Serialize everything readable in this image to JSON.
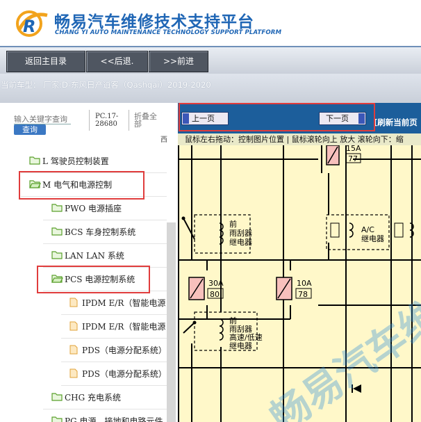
{
  "header": {
    "title": "畅易汽车维修技术支持平台",
    "subtitle": "CHANG YI AUTO MAINTENANCE TECHNOLOGY SUPPORT PLATFORM"
  },
  "toolbar": {
    "home_label": "返回主目录",
    "back_label": "<<后退.",
    "forward_label": ">>前进"
  },
  "vehicle": {
    "text": "当前车型：   厂家:D-东风日产逍客（Qashqai）2019-2020"
  },
  "sidebar": {
    "search_placeholder": "输入关键字查询",
    "search_button": "查询",
    "pc_code": "PC.17-28680",
    "collapse_label": "折叠全部",
    "tiny_glyph": "西",
    "items": [
      {
        "label": "L 驾驶员控制装置",
        "kind": "folder"
      },
      {
        "label": "M 电气和电源控制",
        "kind": "folder-open"
      },
      {
        "label": "PWO 电源插座",
        "kind": "folder"
      },
      {
        "label": "BCS 车身控制系统",
        "kind": "folder"
      },
      {
        "label": "LAN LAN 系统",
        "kind": "folder"
      },
      {
        "label": "PCS 电源控制系统",
        "kind": "folder-open"
      },
      {
        "label": "IPDM E/R（智能电源",
        "kind": "page"
      },
      {
        "label": "IPDM E/R（智能电源",
        "kind": "page"
      },
      {
        "label": "PDS（电源分配系统）",
        "kind": "page"
      },
      {
        "label": "PDS（电源分配系统）",
        "kind": "page"
      },
      {
        "label": "CHG 充电系统",
        "kind": "folder"
      },
      {
        "label": "PG 电源、接地和电路元件",
        "kind": "folder"
      }
    ]
  },
  "content": {
    "prev_page": "上一页",
    "next_page": "下一页",
    "refresh_label": "[刷新当前页",
    "hint": "鼠标左右拖动：控制图片位置 | 鼠标滚轮向上 放大  滚轮向下：缩",
    "diagram": {
      "fuse_top": "15A",
      "fuse_top_num": "77",
      "relay1_label": [
        "前",
        "雨刮器",
        "继电器"
      ],
      "ac_relay_label": [
        "A/C",
        "继电器"
      ],
      "fuse_left": "30A",
      "fuse_left_num": "80",
      "fuse_mid": "10A",
      "fuse_mid_num": "78",
      "relay2_label": [
        "前",
        "雨刮器",
        "高速/低速",
        "继电器"
      ],
      "watermark": "畅易汽车维修"
    }
  },
  "colors": {
    "brand_blue": "#1f66b5",
    "highlight_red": "#e03c3c",
    "nav_dark": "#4f5661",
    "content_strip": "#1c5e9b"
  }
}
